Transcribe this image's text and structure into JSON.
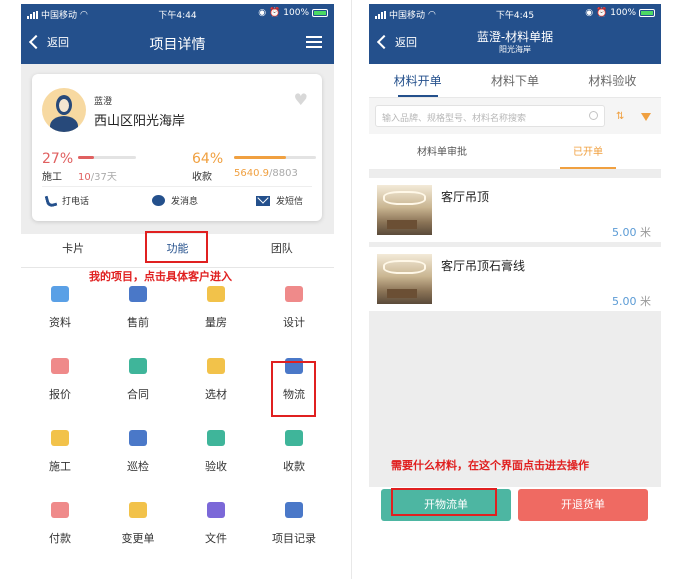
{
  "left_phone": {
    "status": {
      "carrier": "中国移动",
      "time": "下午4:44",
      "battery": "100%"
    },
    "nav": {
      "back_label": "返回",
      "title": "项目详情"
    },
    "client": {
      "name": "蓝澄",
      "address": "西山区阳光海岸",
      "construction": {
        "percent": "27%",
        "fill": 0.27,
        "label": "施工",
        "done": "10",
        "total": "/37天"
      },
      "payment": {
        "percent": "64%",
        "fill": 0.64,
        "label": "收款",
        "done": "5640.9",
        "total": "/8803"
      },
      "actions": {
        "call": "打电话",
        "message": "发消息",
        "sms": "发短信"
      }
    },
    "tabs": [
      "卡片",
      "功能",
      "团队"
    ],
    "active_tab": "功能",
    "annotation": "我的项目，点击具体客户进入",
    "grid": [
      {
        "label": "资料",
        "icon": "id-card-icon",
        "color": "#5aa0e6"
      },
      {
        "label": "售前",
        "icon": "tag-icon",
        "color": "#4a78c8"
      },
      {
        "label": "量房",
        "icon": "ruler-icon",
        "color": "#f2c24a"
      },
      {
        "label": "设计",
        "icon": "design-icon",
        "color": "#ef8a8a"
      },
      {
        "label": "报价",
        "icon": "quote-icon",
        "color": "#ef8a8a"
      },
      {
        "label": "合同",
        "icon": "contract-icon",
        "color": "#3fb59a"
      },
      {
        "label": "选材",
        "icon": "cart-icon",
        "color": "#f2c24a"
      },
      {
        "label": "物流",
        "icon": "truck-icon",
        "color": "#4a78c8"
      },
      {
        "label": "施工",
        "icon": "paint-roller-icon",
        "color": "#f2c24a"
      },
      {
        "label": "巡检",
        "icon": "clipboard-icon",
        "color": "#4a78c8"
      },
      {
        "label": "验收",
        "icon": "check-doc-icon",
        "color": "#3fb59a"
      },
      {
        "label": "收款",
        "icon": "wallet-icon",
        "color": "#3fb59a"
      },
      {
        "label": "付款",
        "icon": "payment-icon",
        "color": "#ef8a8a"
      },
      {
        "label": "变更单",
        "icon": "change-order-icon",
        "color": "#f2c24a"
      },
      {
        "label": "文件",
        "icon": "folder-icon",
        "color": "#7b68d8"
      },
      {
        "label": "项目记录",
        "icon": "clock-icon",
        "color": "#4a78c8"
      }
    ]
  },
  "right_phone": {
    "status": {
      "carrier": "中国移动",
      "time": "下午4:45",
      "battery": "100%"
    },
    "nav": {
      "back_label": "返回",
      "title": "蓝澄-材料单据",
      "subtitle": "阳光海岸"
    },
    "tabs": [
      "材料开单",
      "材料下单",
      "材料验收"
    ],
    "active_tab": "材料开单",
    "search_placeholder": "输入品牌、规格型号、材料名称搜索",
    "subtabs": [
      "材料单审批",
      "已开单"
    ],
    "active_subtab": "已开单",
    "items": [
      {
        "title": "客厅吊顶",
        "qty": "5.00",
        "unit": "米"
      },
      {
        "title": "客厅吊顶石膏线",
        "qty": "5.00",
        "unit": "米"
      }
    ],
    "annotation": "需要什么材料，在这个界面点击进去操作",
    "buttons": {
      "logistics": "开物流单",
      "return": "开退货单"
    }
  }
}
